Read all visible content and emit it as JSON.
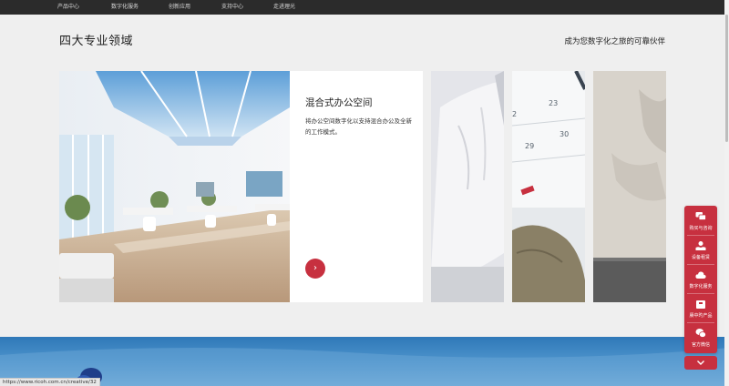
{
  "nav": {
    "items": [
      "产品中心",
      "数字化服务",
      "创新应用",
      "支持中心",
      "走进理光"
    ]
  },
  "section": {
    "title": "四大专业领域",
    "tagline": "成为您数字化之旅的可靠伙伴"
  },
  "feature": {
    "title": "混合式办公空间",
    "description": "将办公空间数字化以支持混合办公及全新的工作模式。",
    "arrow": "›"
  },
  "float_panel": {
    "items": [
      {
        "label": "购买与咨询",
        "icon": "chat-bubbles-icon"
      },
      {
        "label": "设备租赁",
        "icon": "hand-coin-icon"
      },
      {
        "label": "数字化服务",
        "icon": "cloud-icon"
      },
      {
        "label": "赓中旳产品",
        "icon": "box-icon"
      },
      {
        "label": "官方微信",
        "icon": "wechat-icon"
      }
    ]
  },
  "status_url": "https://www.ricoh.com.cn/creative/32",
  "colors": {
    "accent": "#c7303f",
    "nav_bg": "#2b2b2b",
    "page_bg": "#efefef"
  }
}
